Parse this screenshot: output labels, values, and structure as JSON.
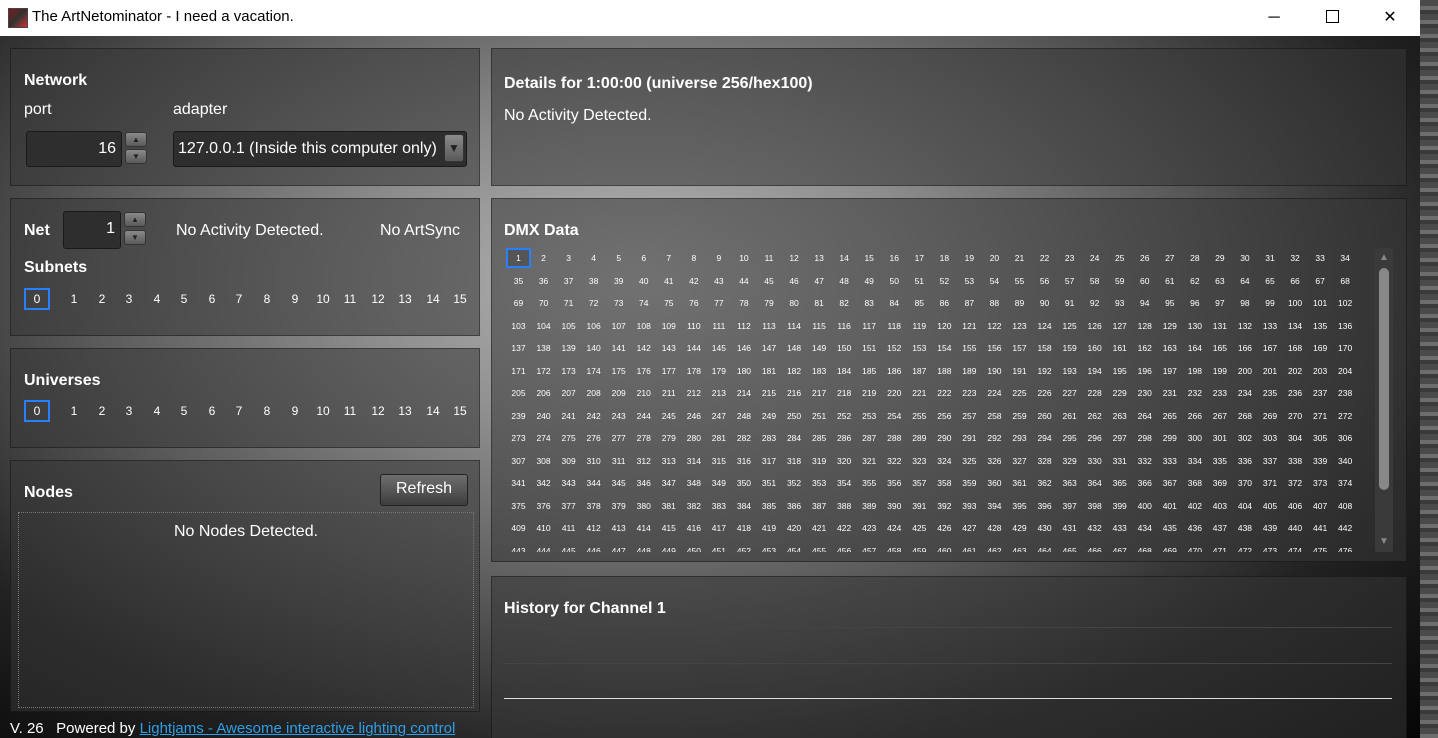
{
  "window": {
    "title": "The ArtNetominator - I need a vacation.",
    "minimize_glyph": "─",
    "close_glyph": "✕"
  },
  "network": {
    "title": "Network",
    "port_label": "port",
    "adapter_label": "adapter",
    "port_value": "16",
    "adapter_value": "127.0.0.1 (Inside this computer only)"
  },
  "net": {
    "label": "Net",
    "value": "1",
    "activity": "No Activity Detected.",
    "artsync": "No ArtSync",
    "subnets_label": "Subnets",
    "subnets": [
      "0",
      "1",
      "2",
      "3",
      "4",
      "5",
      "6",
      "7",
      "8",
      "9",
      "10",
      "11",
      "12",
      "13",
      "14",
      "15"
    ],
    "selected_subnet": "0"
  },
  "universes": {
    "label": "Universes",
    "items": [
      "0",
      "1",
      "2",
      "3",
      "4",
      "5",
      "6",
      "7",
      "8",
      "9",
      "10",
      "11",
      "12",
      "13",
      "14",
      "15"
    ],
    "selected": "0"
  },
  "nodes": {
    "label": "Nodes",
    "refresh_label": "Refresh",
    "empty_message": "No Nodes Detected."
  },
  "details": {
    "title": "Details for 1:00:00 (universe 256/hex100)",
    "status": "No Activity Detected."
  },
  "dmx": {
    "title": "DMX Data",
    "channel_count": 512,
    "selected_channel": 1,
    "scroll_up_glyph": "▲",
    "scroll_down_glyph": "▼"
  },
  "history": {
    "title": "History for Channel 1"
  },
  "footer": {
    "version": "V. 26",
    "powered_by": "Powered by",
    "link_text": "Lightjams - Awesome interactive lighting control"
  },
  "colors": {
    "selection": "#2a7fff",
    "link": "#2e9fe6"
  }
}
